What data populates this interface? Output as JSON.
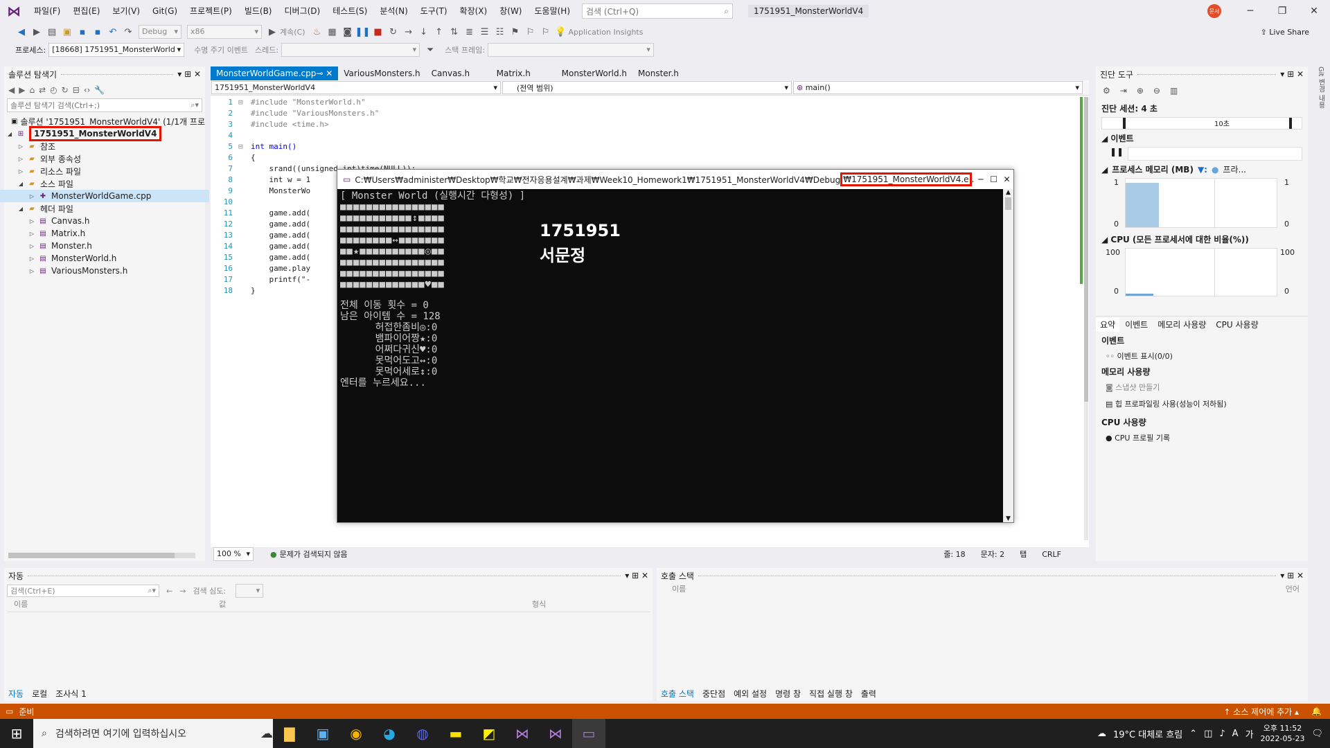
{
  "menu": {
    "items": [
      "파일(F)",
      "편집(E)",
      "보기(V)",
      "Git(G)",
      "프로젝트(P)",
      "빌드(B)",
      "디버그(D)",
      "테스트(S)",
      "분석(N)",
      "도구(T)",
      "확장(X)",
      "창(W)",
      "도움말(H)"
    ],
    "search_placeholder": "검색 (Ctrl+Q)",
    "solution_title": "1751951_MonsterWorldV4",
    "avatar_text": "문서"
  },
  "toolbar": {
    "config": "Debug",
    "platform": "x86",
    "continue_label": "계속(C)",
    "insights": "Application Insights",
    "live_share": "Live Share"
  },
  "procbar": {
    "process_label": "프로세스:",
    "process_value": "[18668] 1751951_MonsterWorld",
    "lifecycle": "수명 주기 이벤트",
    "thread": "스레드:",
    "stack_frame": "스택 프레임:"
  },
  "solution_explorer": {
    "title": "솔루션 탐색기",
    "search_placeholder": "솔루션 탐색기 검색(Ctrl+;)",
    "solution_node": "솔루션 '1751951_MonsterWorldV4' (1/1개 프로",
    "project": "1751951_MonsterWorldV4",
    "items": [
      {
        "label": "참조",
        "indent": 2
      },
      {
        "label": "외부 종속성",
        "indent": 2
      },
      {
        "label": "리소스 파일",
        "indent": 2
      },
      {
        "label": "소스 파일",
        "indent": 2
      },
      {
        "label": "MonsterWorldGame.cpp",
        "indent": 3
      },
      {
        "label": "헤더 파일",
        "indent": 2
      },
      {
        "label": "Canvas.h",
        "indent": 3
      },
      {
        "label": "Matrix.h",
        "indent": 3
      },
      {
        "label": "Monster.h",
        "indent": 3
      },
      {
        "label": "MonsterWorld.h",
        "indent": 3
      },
      {
        "label": "VariousMonsters.h",
        "indent": 3
      }
    ]
  },
  "editor": {
    "tabs": [
      "MonsterWorldGame.cpp",
      "VariousMonsters.h",
      "Canvas.h",
      "Matrix.h",
      "MonsterWorld.h",
      "Monster.h"
    ],
    "nav_project": "1751951_MonsterWorldV4",
    "nav_scope": "(전역 범위)",
    "nav_func": "main()",
    "lines": [
      "#include \"MonsterWorld.h\"",
      "#include \"VariousMonsters.h\"",
      "#include <time.h>",
      "",
      "int main()",
      "{",
      "    srand((unsigned int)time(NULL));",
      "    int w = 1",
      "    MonsterWo",
      "",
      "    game.add(",
      "    game.add(",
      "    game.add(",
      "    game.add(",
      "    game.add(",
      "    game.play",
      "    printf(\"-",
      "}"
    ],
    "zoom": "100 %",
    "issues": "문제가 검색되지 않음",
    "status_line": "줄: 18",
    "status_col": "문자: 2",
    "status_tab": "탭",
    "status_crlf": "CRLF"
  },
  "console": {
    "title": "C:₩Users₩administer₩Desktop₩학교₩전자응용설계₩과제₩Week10_Homework1₩1751951_MonsterWorldV4₩Debug",
    "title_highlight": "₩1751951_MonsterWorldV4.e",
    "header": "[ Monster World (실행시간 다형성) ]",
    "grid": [
      "■■■■■■■■■■■■■■■■",
      "■■■■■■■■■■■↕■■■■",
      "■■■■■■■■■■■■■■■■",
      "■■■■■■■■↔■■■■■■■",
      "■■★■■■■■■■■■■◎■■",
      "■■■■■■■■■■■■■■■■",
      "■■■■■■■■■■■■■■■■",
      "■■■■■■■■■■■■■♥■■"
    ],
    "student_id": "1751951",
    "student_name": "서문정",
    "stats": [
      "전체 이동 횟수 = 0",
      "남은 아이템 수 = 128",
      "      허접한좀비◎:0",
      "      뱀파이어짱★:0",
      "      어쩌다귀신♥:0",
      "      못먹어도고↔:0",
      "      못먹어세로↕:0",
      "엔터를 누르세요..."
    ]
  },
  "diag": {
    "title": "진단 도구",
    "session": "진단 세션: 4 초",
    "timeline_label": "10초",
    "events": "이벤트",
    "memory": "프로세스 메모리 (MB)",
    "memory_legend": "프라...",
    "mem_max": "1",
    "mem_min": "0",
    "cpu": "CPU (모든 프로세서에 대한 비율(%))",
    "cpu_max": "100",
    "cpu_min": "0",
    "tabs": [
      "요약",
      "이벤트",
      "메모리 사용량",
      "CPU 사용량"
    ],
    "sec_events": "이벤트",
    "show_events": "이벤트 표시(0/0)",
    "sec_memory": "메모리 사용량",
    "snapshot": "스냅샷 만들기",
    "heap": "힙 프로파일링 사용(성능이 저하됨)",
    "sec_cpu": "CPU 사용량",
    "cpu_record": "CPU 프로필 기록",
    "side_label": "Git 변경 내용"
  },
  "autos": {
    "title": "자동",
    "search_placeholder": "검색(Ctrl+E)",
    "search_depth": "검색 심도:",
    "cols": [
      "이름",
      "값",
      "형식"
    ],
    "tabs": [
      "자동",
      "로컬",
      "조사식 1"
    ]
  },
  "callstack": {
    "title": "호출 스택",
    "cols": [
      "이름",
      "언어"
    ],
    "tabs": [
      "호출 스택",
      "중단점",
      "예외 설정",
      "명령 창",
      "직접 실행 창",
      "출력"
    ]
  },
  "status": {
    "ready": "준비",
    "source_control": "소스 제어에 추가"
  },
  "taskbar": {
    "search_placeholder": "검색하려면 여기에 입력하십시오",
    "weather": "19°C 대체로 흐림",
    "time": "오후 11:52",
    "date": "2022-05-23",
    "ime": "A",
    "ime2": "가"
  },
  "colors": {
    "accent": "#007acc",
    "status": "#ca5100",
    "highlight": "#e51400"
  }
}
